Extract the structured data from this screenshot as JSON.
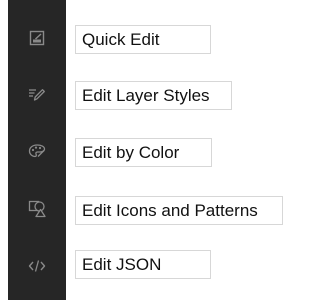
{
  "sidebar": {
    "items": [
      {
        "icon": "quick-edit-icon",
        "label": "Quick Edit"
      },
      {
        "icon": "layer-styles-pen-icon",
        "label": "Edit Layer Styles"
      },
      {
        "icon": "color-palette-icon",
        "label": "Edit by Color"
      },
      {
        "icon": "icons-patterns-shapes-icon",
        "label": "Edit Icons and Patterns"
      },
      {
        "icon": "code-brackets-icon",
        "label": "Edit JSON"
      }
    ]
  },
  "colors": {
    "sidebar_bg": "#262626",
    "icon_color": "#8a8a8a",
    "label_border": "#d7d7d7",
    "label_text": "#111111"
  }
}
